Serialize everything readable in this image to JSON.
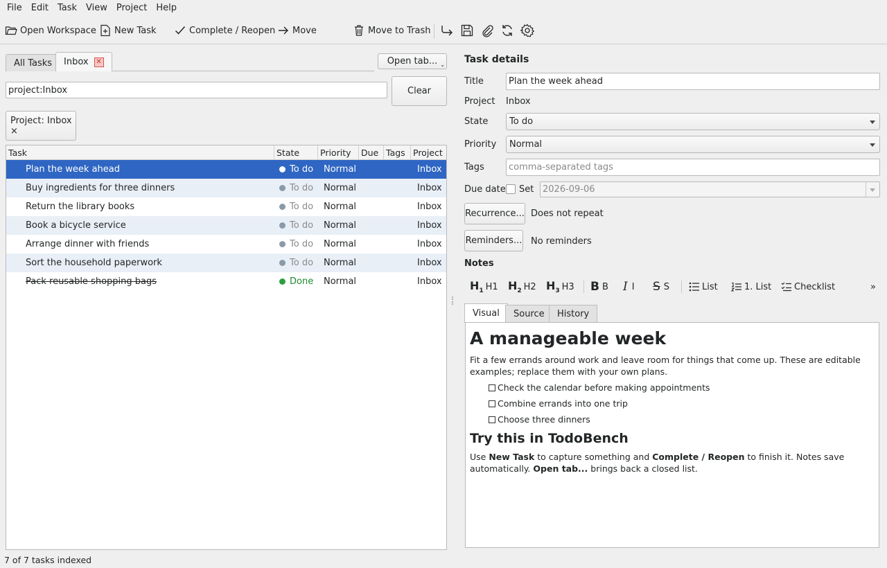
{
  "menu": [
    "File",
    "Edit",
    "Task",
    "View",
    "Project",
    "Help"
  ],
  "toolbar": {
    "open_workspace": "Open Workspace",
    "new_task": "New Task",
    "complete_reopen": "Complete / Reopen",
    "move": "Move",
    "move_to_trash": "Move to Trash",
    "icons": [
      "redo-icon",
      "save-icon",
      "attach-icon",
      "refresh-icon",
      "settings-icon"
    ]
  },
  "tabs": {
    "all_tasks": "All Tasks",
    "inbox": "Inbox",
    "open_tab": "Open tab..."
  },
  "search": {
    "value": "project:Inbox",
    "clear": "Clear"
  },
  "filter_chip": "Project: Inbox ×",
  "table": {
    "columns": [
      "Task",
      "State",
      "Priority",
      "Due",
      "Tags",
      "Project"
    ],
    "rows": [
      {
        "task": "Plan the week ahead",
        "state": "To do",
        "priority": "Normal",
        "due": "",
        "tags": "",
        "project": "Inbox",
        "selected": true,
        "done": false
      },
      {
        "task": "Buy ingredients for three dinners",
        "state": "To do",
        "priority": "Normal",
        "due": "",
        "tags": "",
        "project": "Inbox",
        "selected": false,
        "done": false
      },
      {
        "task": "Return the library books",
        "state": "To do",
        "priority": "Normal",
        "due": "",
        "tags": "",
        "project": "Inbox",
        "selected": false,
        "done": false
      },
      {
        "task": "Book a bicycle service",
        "state": "To do",
        "priority": "Normal",
        "due": "",
        "tags": "",
        "project": "Inbox",
        "selected": false,
        "done": false
      },
      {
        "task": "Arrange dinner with friends",
        "state": "To do",
        "priority": "Normal",
        "due": "",
        "tags": "",
        "project": "Inbox",
        "selected": false,
        "done": false
      },
      {
        "task": "Sort the household paperwork",
        "state": "To do",
        "priority": "Normal",
        "due": "",
        "tags": "",
        "project": "Inbox",
        "selected": false,
        "done": false
      },
      {
        "task": "Pack reusable shopping bags",
        "state": "Done",
        "priority": "Normal",
        "due": "",
        "tags": "",
        "project": "Inbox",
        "selected": false,
        "done": true
      }
    ]
  },
  "details": {
    "heading": "Task details",
    "title_label": "Title",
    "title_value": "Plan the week ahead",
    "project_label": "Project",
    "project_value": "Inbox",
    "state_label": "State",
    "state_value": "To do",
    "priority_label": "Priority",
    "priority_value": "Normal",
    "tags_label": "Tags",
    "tags_placeholder": "comma-separated tags",
    "due_label": "Due date",
    "due_set_label": "Set",
    "due_value": "2026-09-06",
    "recurrence_button": "Recurrence...",
    "recurrence_value": "Does not repeat",
    "reminders_button": "Reminders...",
    "reminders_value": "No reminders",
    "notes_label": "Notes"
  },
  "notes_toolbar": {
    "h1": "H1",
    "h2": "H2",
    "h3": "H3",
    "bold": "B",
    "italic": "I",
    "strike": "S",
    "list": "List",
    "numbered": "1. List",
    "checklist": "Checklist",
    "more": "»"
  },
  "notes_tabs": [
    "Visual",
    "Source",
    "History"
  ],
  "notes": {
    "heading": "A manageable week",
    "intro": "Fit a few errands around work and leave room for things that come up. These are editable examples; replace them with your own plans.",
    "checklist": [
      "Check the calendar before making appointments",
      "Combine errands into one trip",
      "Choose three dinners"
    ],
    "heading2": "Try this in TodoBench",
    "p2_a": "Use ",
    "p2_b": "New Task",
    "p2_c": " to capture something and ",
    "p2_d": "Complete / Reopen",
    "p2_e": " to finish it. Notes save automatically. ",
    "p2_f": "Open tab...",
    "p2_g": " brings back a closed list."
  },
  "status": "7 of 7 tasks indexed"
}
